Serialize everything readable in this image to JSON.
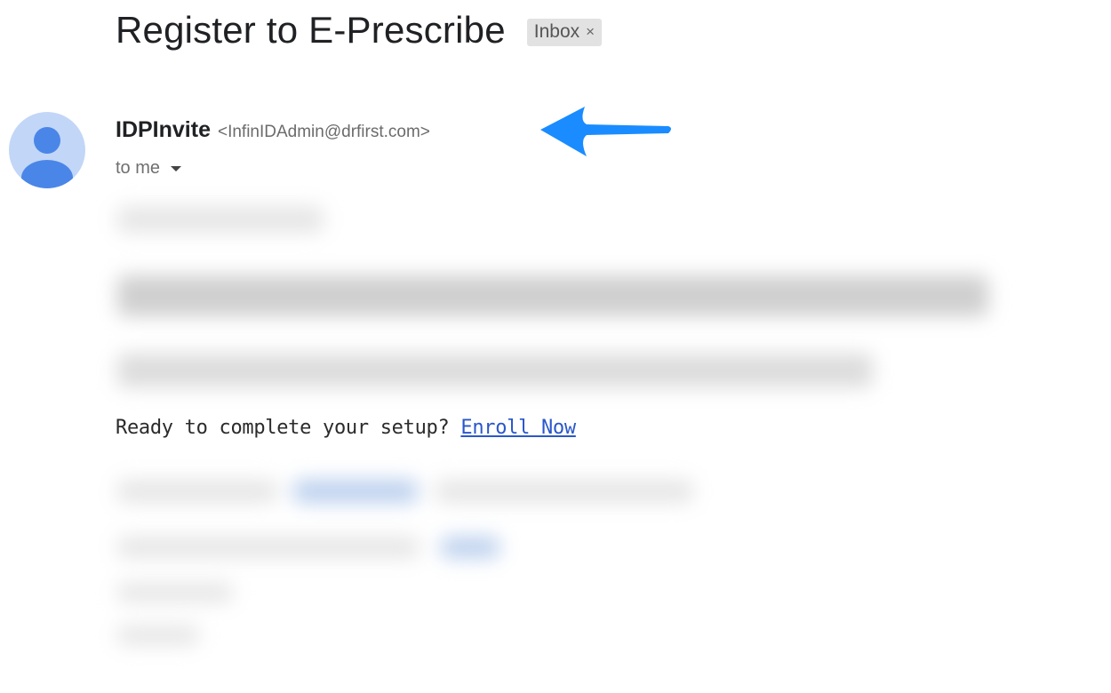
{
  "email": {
    "subject": "Register to E-Prescribe",
    "label": {
      "name": "Inbox",
      "close_glyph": "×"
    },
    "sender": {
      "name": "IDPInvite",
      "email": "<InfinIDAdmin@drfirst.com>",
      "avatar_icon": "person-icon"
    },
    "recipient": "to me",
    "body": {
      "cta_text": "Ready to complete your setup?",
      "cta_link": "Enroll Now"
    }
  },
  "annotation": {
    "icon": "arrow-left-icon",
    "color": "#1a8cff"
  },
  "colors": {
    "avatar_bg": "#c2d6f7",
    "avatar_fg": "#4a86e8",
    "link": "#2a57c9"
  }
}
